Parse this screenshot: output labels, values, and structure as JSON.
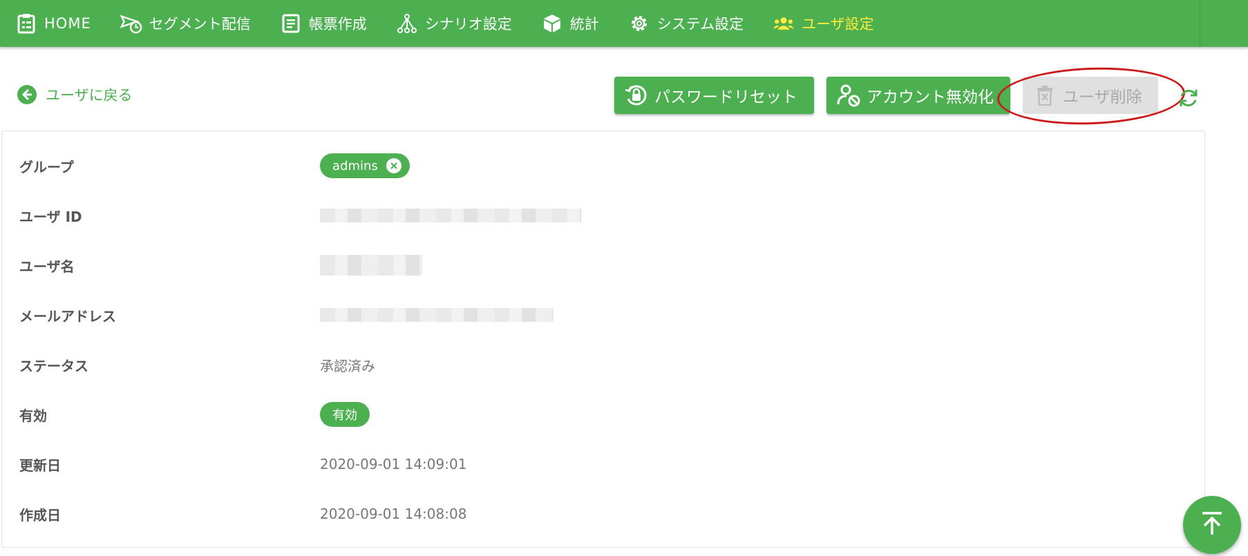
{
  "nav": {
    "items": [
      {
        "label": "HOME",
        "icon": "clipboard-icon"
      },
      {
        "label": "セグメント配信",
        "icon": "send-clock-icon"
      },
      {
        "label": "帳票作成",
        "icon": "document-icon"
      },
      {
        "label": "シナリオ設定",
        "icon": "scenario-tree-icon"
      },
      {
        "label": "統計",
        "icon": "cube-icon"
      },
      {
        "label": "システム設定",
        "icon": "gear-icon"
      },
      {
        "label": "ユーザ設定",
        "icon": "users-icon"
      }
    ],
    "active_color": "#ffeb3b",
    "bar_color": "#4caf50"
  },
  "toolbar": {
    "back_label": "ユーザに戻る",
    "reset_password_label": "パスワードリセット",
    "disable_account_label": "アカウント無効化",
    "delete_user_label": "ユーザ削除"
  },
  "detail": {
    "group_label": "グループ",
    "group_chip": "admins",
    "user_id_label": "ユーザ ID",
    "user_name_label": "ユーザ名",
    "email_label": "メールアドレス",
    "status_label": "ステータス",
    "status_value": "承認済み",
    "enabled_label": "有効",
    "enabled_chip": "有効",
    "updated_label": "更新日",
    "updated_value": "2020-09-01 14:09:01",
    "created_label": "作成日",
    "created_value": "2020-09-01 14:08:08"
  },
  "colors": {
    "accent": "#4caf50",
    "annotation": "#cc1a1a",
    "disabled_bg": "#e0e0e0"
  }
}
